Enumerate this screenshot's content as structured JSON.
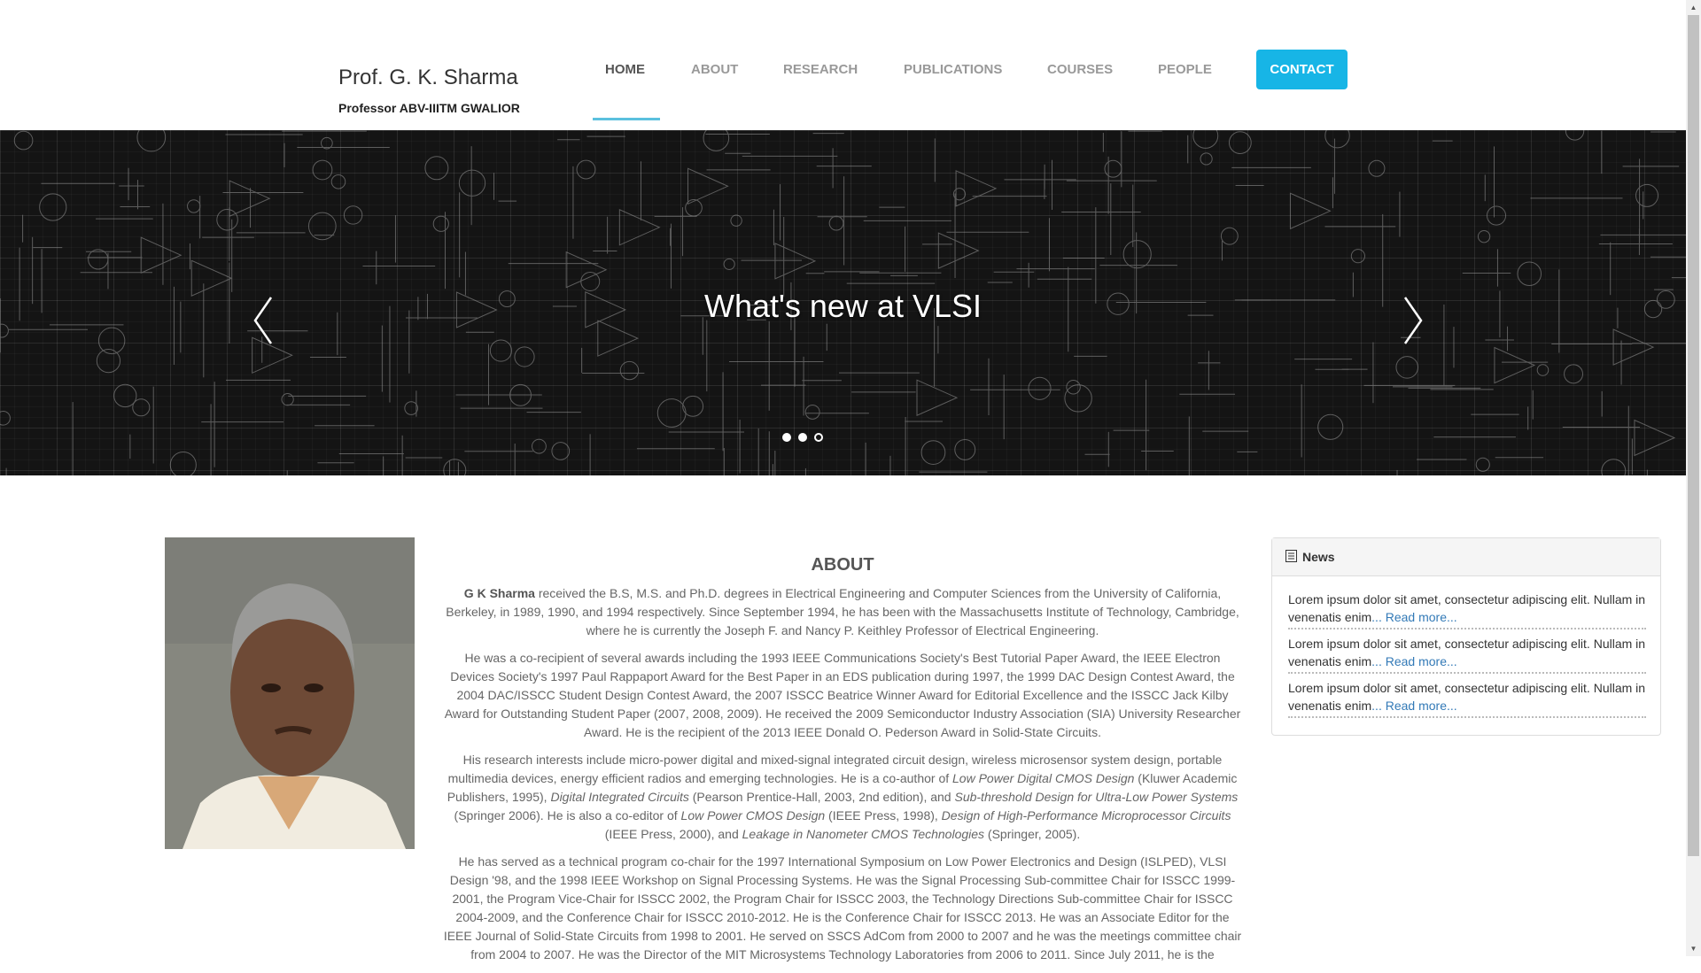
{
  "brand": {
    "name": "Prof. G. K. Sharma",
    "subtitle": "Professor ABV-IIITM GWALIOR"
  },
  "nav": {
    "items": [
      "HOME",
      "ABOUT",
      "RESEARCH",
      "PUBLICATIONS",
      "COURSES",
      "PEOPLE"
    ],
    "contact": "CONTACT",
    "active": "HOME",
    "accent_color": "#17b5e6"
  },
  "hero": {
    "title": "What's new at VLSI",
    "slide_count": 3,
    "active_slide": 3
  },
  "about": {
    "heading": "ABOUT",
    "name": "G K Sharma",
    "p1": " received the B.S, M.S. and Ph.D. degrees in Electrical Engineering and Computer Sciences from the University of California, Berkeley, in 1989, 1990, and 1994 respectively. Since September 1994, he has been with the Massachusetts Institute of Technology, Cambridge, where he is currently the Joseph F. and Nancy P. Keithley Professor of Electrical Engineering.",
    "p2": "He was a co-recipient of several awards including the 1993 IEEE Communications Society's Best Tutorial Paper Award, the IEEE Electron Devices Society's 1997 Paul Rappaport Award for the Best Paper in an EDS publication during 1997, the 1999 DAC Design Contest Award, the 2004 DAC/ISSCC Student Design Contest Award, the 2007 ISSCC Beatrice Winner Award for Editorial Excellence and the ISSCC Jack Kilby Award for Outstanding Student Paper (2007, 2008, 2009). He received the 2009 Semiconductor Industry Association (SIA) University Researcher Award. He is the recipient of the 2013 IEEE Donald O. Pederson Award in Solid-State Circuits.",
    "p3": [
      {
        "t": "His research interests include micro-power digital and mixed-signal integrated circuit design, wireless microsensor system design, portable multimedia devices, energy efficient radios and emerging technologies. He is a co-author of ",
        "i": false
      },
      {
        "t": "Low Power Digital CMOS Design",
        "i": true
      },
      {
        "t": " (Kluwer Academic Publishers, 1995), ",
        "i": false
      },
      {
        "t": "Digital Integrated Circuits",
        "i": true
      },
      {
        "t": " (Pearson Prentice-Hall, 2003, 2nd edition), and ",
        "i": false
      },
      {
        "t": "Sub-threshold Design for Ultra-Low Power Systems",
        "i": true
      },
      {
        "t": " (Springer 2006). He is also a co-editor of ",
        "i": false
      },
      {
        "t": "Low Power CMOS Design",
        "i": true
      },
      {
        "t": " (IEEE Press, 1998), ",
        "i": false
      },
      {
        "t": "Design of High-Performance Microprocessor Circuits",
        "i": true
      },
      {
        "t": " (IEEE Press, 2000), and ",
        "i": false
      },
      {
        "t": "Leakage in Nanometer CMOS Technologies",
        "i": true
      },
      {
        "t": " (Springer, 2005).",
        "i": false
      }
    ],
    "p4": "He has served as a technical program co-chair for the 1997 International Symposium on Low Power Electronics and Design (ISLPED), VLSI Design '98, and the 1998 IEEE Workshop on Signal Processing Systems. He was the Signal Processing Sub-committee Chair for ISSCC 1999-2001, the Program Vice-Chair for ISSCC 2002, the Program Chair for ISSCC 2003, the Technology Directions Sub-committee Chair for ISSCC 2004-2009, and the Conference Chair for ISSCC 2010-2012. He is the Conference Chair for ISSCC 2013. He was an Associate Editor for the IEEE Journal of Solid-State Circuits from 1998 to 2001. He served on SSCS AdCom from 2000 to 2007 and he was the meetings committee chair from 2004 to 2007. He was the Director of the MIT Microsystems Technology Laboratories from 2006 to 2011. Since July 2011, he is the"
  },
  "news": {
    "title": "News",
    "items": [
      {
        "text": "Lorem ipsum dolor sit amet, consectetur adipiscing elit. Nullam in venenatis enim",
        "link": "... Read more..."
      },
      {
        "text": "Lorem ipsum dolor sit amet, consectetur adipiscing elit. Nullam in venenatis enim",
        "link": "... Read more..."
      },
      {
        "text": "Lorem ipsum dolor sit amet, consectetur adipiscing elit. Nullam in venenatis enim",
        "link": "... Read more..."
      }
    ]
  },
  "icons": {
    "news": "document-list-icon",
    "prev": "chevron-left-icon",
    "next": "chevron-right-icon"
  }
}
